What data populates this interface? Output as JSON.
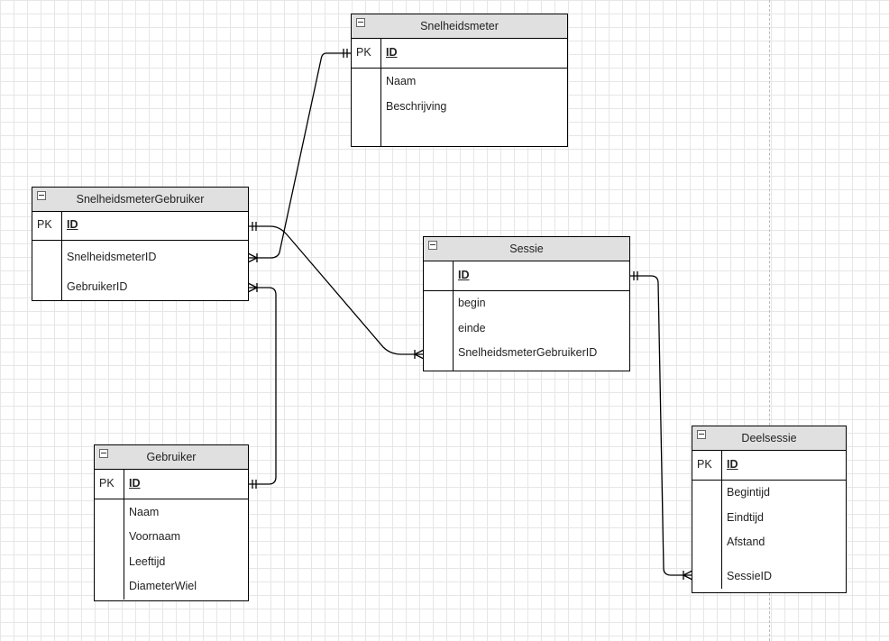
{
  "entities": {
    "snelheidsmeter": {
      "title": "Snelheidsmeter",
      "key_label": "PK",
      "id_label": "ID",
      "attributes": [
        "Naam",
        "Beschrijving"
      ]
    },
    "snelheidsmeter_gebruiker": {
      "title": "SnelheidsmeterGebruiker",
      "key_label": "PK",
      "id_label": "ID",
      "attributes": [
        "SnelheidsmeterID",
        "GebruikerID"
      ]
    },
    "sessie": {
      "title": "Sessie",
      "key_label": "",
      "id_label": "ID",
      "attributes": [
        "begin",
        "einde",
        "SnelheidsmeterGebruikerID"
      ]
    },
    "gebruiker": {
      "title": "Gebruiker",
      "key_label": "PK",
      "id_label": "ID",
      "attributes": [
        "Naam",
        "Voornaam",
        "Leeftijd",
        "DiameterWiel"
      ]
    },
    "deelsessie": {
      "title": "Deelsessie",
      "key_label": "PK",
      "id_label": "ID",
      "attributes": [
        "Begintijd",
        "Eindtijd",
        "Afstand",
        "SessieID"
      ]
    }
  },
  "relationships": [
    {
      "from": "Snelheidsmeter.ID",
      "to": "SnelheidsmeterGebruiker.SnelheidsmeterID",
      "from_end": "one",
      "to_end": "one-or-many"
    },
    {
      "from": "SnelheidsmeterGebruiker.ID",
      "to": "Sessie.SnelheidsmeterGebruikerID",
      "from_end": "one",
      "to_end": "one-or-many"
    },
    {
      "from": "Gebruiker.ID",
      "to": "SnelheidsmeterGebruiker.GebruikerID",
      "from_end": "one",
      "to_end": "one-or-many"
    },
    {
      "from": "Sessie.ID",
      "to": "Deelsessie.SessieID",
      "from_end": "one",
      "to_end": "one-or-many"
    }
  ]
}
